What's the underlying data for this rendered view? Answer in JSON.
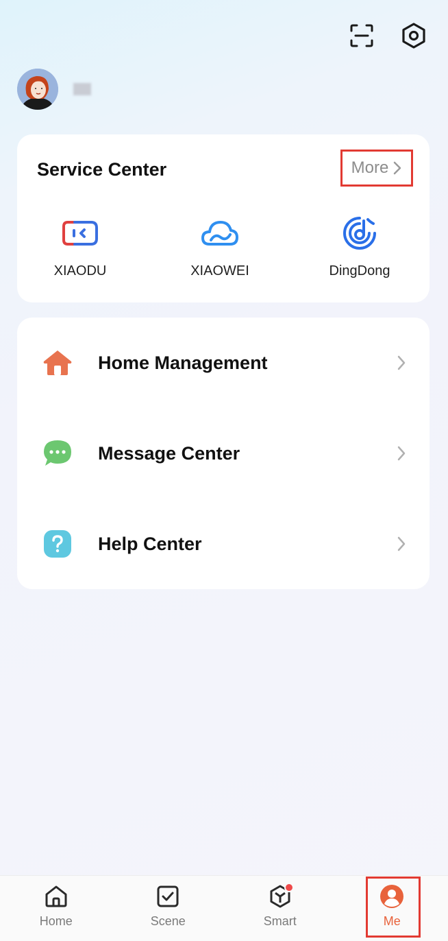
{
  "header": {
    "scan_icon": "scan-icon",
    "settings_icon": "settings-icon"
  },
  "profile": {
    "username": "■■"
  },
  "service_center": {
    "title": "Service Center",
    "more_label": "More",
    "services": [
      {
        "label": "XIAODU",
        "icon": "xiaodu-icon"
      },
      {
        "label": "XIAOWEI",
        "icon": "xiaowei-cloud-icon"
      },
      {
        "label": "DingDong",
        "icon": "dingdong-icon"
      }
    ]
  },
  "menu": {
    "items": [
      {
        "label": "Home Management",
        "icon": "home-icon",
        "color": "#e8734f"
      },
      {
        "label": "Message Center",
        "icon": "message-icon",
        "color": "#6cc770"
      },
      {
        "label": "Help Center",
        "icon": "help-icon",
        "color": "#5ec8e0"
      }
    ]
  },
  "tabbar": {
    "tabs": [
      {
        "label": "Home",
        "icon": "home-tab-icon"
      },
      {
        "label": "Scene",
        "icon": "scene-tab-icon"
      },
      {
        "label": "Smart",
        "icon": "smart-tab-icon"
      },
      {
        "label": "Me",
        "icon": "me-tab-icon",
        "active": true
      }
    ]
  },
  "colors": {
    "accent": "#e8623b",
    "highlight_box": "#e23a32"
  }
}
